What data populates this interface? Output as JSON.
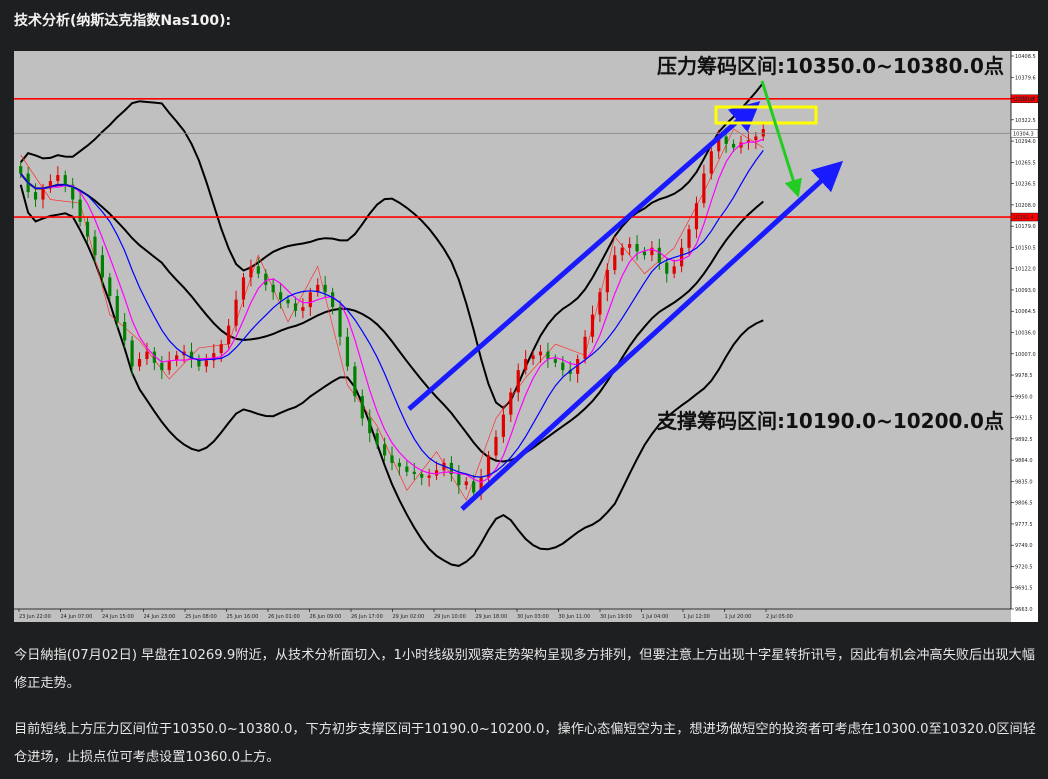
{
  "heading": "技术分析(纳斯达克指数Nas100):",
  "paragraphs": [
    "今日納指(07月02日) 早盘在10269.9附近，从技术分析面切入，1小时线级别观察走势架构呈现多方排列，但要注意上方出现十字星转折讯号，因此有机会冲高失败后出现大幅修正走势。",
    "目前短线上方压力区间位于10350.0~10380.0，下方初步支撑区间于10190.0~10200.0，操作心态偏短空为主，想进场做短空的投资者可考虑在10300.0至10320.0区间轻仓进场，止损点位可考虑设置10360.0上方。"
  ],
  "chart_data": {
    "type": "candlestick",
    "instrument": "Nas100",
    "timeframe": "1H",
    "colors": {
      "background": "#c0c0c0",
      "bull_candle": "#e00000",
      "bear_candle": "#008000",
      "ma_fast": "#ff00ff",
      "ma_slow": "#0000ff",
      "bollinger": "#000000",
      "zigzag": "#ff3030",
      "level_lines": "#ff0000",
      "channel_arrows": "#1a1aff",
      "signal_arrow": "#22cc22",
      "resistance_box": "#ffff00"
    },
    "y_ticks": [
      "10408.5",
      "10379.6",
      "10350.8",
      "10322.5",
      "10294.0",
      "10265.5",
      "10236.5",
      "10208.0",
      "10179.0",
      "10150.5",
      "10122.0",
      "10093.0",
      "10064.5",
      "10036.0",
      "10007.0",
      "9978.5",
      "9950.0",
      "9921.5",
      "9892.5",
      "9864.0",
      "9835.0",
      "9806.5",
      "9777.5",
      "9749.0",
      "9720.5",
      "9691.5",
      "9663.0"
    ],
    "ylim": [
      9663.0,
      10408.5
    ],
    "x_ticks": [
      "23 Jun 22:00",
      "24 Jun 07:00",
      "24 Jun 15:00",
      "24 Jun 23:00",
      "25 Jun 08:00",
      "25 Jun 16:00",
      "26 Jun 01:00",
      "26 Jun 09:00",
      "26 Jun 17:00",
      "29 Jun 02:00",
      "29 Jun 10:00",
      "29 Jun 18:00",
      "30 Jun 03:00",
      "30 Jun 11:00",
      "30 Jun 19:00",
      "1 Jul 04:00",
      "1 Jul 12:00",
      "1 Jul 20:00",
      "2 Jul 05:00"
    ],
    "level_labels": [
      {
        "value": 10350.8,
        "label": "10350.8"
      },
      {
        "value": 10304.3,
        "label": "10304.3"
      },
      {
        "value": 10191.4,
        "label": "10191.4"
      }
    ],
    "annotations": {
      "resistance": "压力筹码区间:10350.0~10380.0点",
      "support": "支撑筹码区间:10190.0~10200.0点"
    },
    "close_series": [
      10250,
      10225,
      10215,
      10230,
      10240,
      10248,
      10235,
      10215,
      10185,
      10165,
      10140,
      10110,
      10085,
      10050,
      10025,
      9990,
      10000,
      10010,
      9995,
      9985,
      9998,
      10005,
      10010,
      10000,
      9990,
      9998,
      10008,
      10020,
      10045,
      10080,
      10110,
      10125,
      10115,
      10100,
      10090,
      10080,
      10075,
      10065,
      10070,
      10090,
      10100,
      10090,
      10070,
      10030,
      9990,
      9950,
      9920,
      9900,
      9885,
      9870,
      9860,
      9855,
      9848,
      9845,
      9840,
      9843,
      9850,
      9860,
      9845,
      9830,
      9835,
      9820,
      9840,
      9870,
      9895,
      9925,
      9955,
      9985,
      10000,
      10005,
      10010,
      10000,
      9995,
      9985,
      9980,
      10000,
      10030,
      10060,
      10090,
      10120,
      10140,
      10150,
      10155,
      10145,
      10140,
      10150,
      10130,
      10115,
      10125,
      10150,
      10175,
      10210,
      10250,
      10280,
      10300,
      10290,
      10285,
      10292,
      10295,
      10300,
      10310
    ]
  }
}
